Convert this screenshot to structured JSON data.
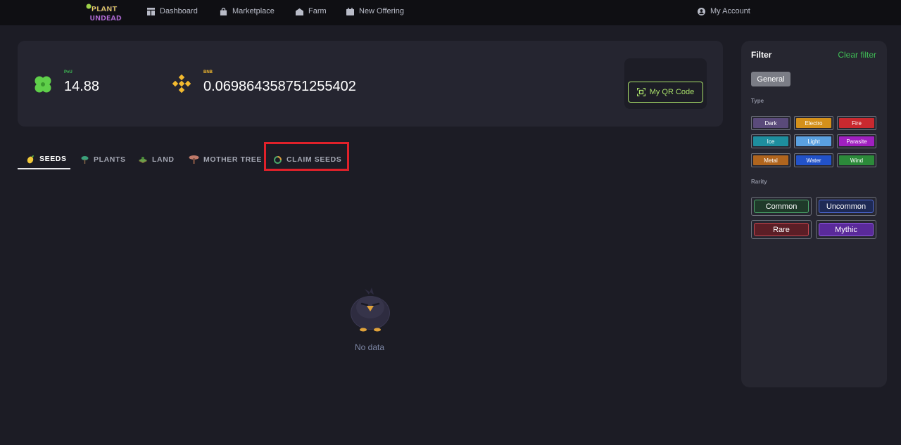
{
  "nav": {
    "logo_top": "PLANT",
    "logo_bottom": "UNDEAD",
    "items": [
      {
        "label": "Dashboard",
        "icon": "dashboard-icon"
      },
      {
        "label": "Marketplace",
        "icon": "marketplace-icon"
      },
      {
        "label": "Farm",
        "icon": "farm-icon"
      },
      {
        "label": "New Offering",
        "icon": "calendar-icon"
      }
    ],
    "account": "My Account"
  },
  "balances": {
    "pvu_label": "PvU",
    "pvu_value": "14.88",
    "bnb_label": "BNB",
    "bnb_value": "0.069864358751255402",
    "qr_button": "My QR Code"
  },
  "tabs": [
    {
      "label": "SEEDS",
      "icon": "seed-icon",
      "active": true
    },
    {
      "label": "PLANTS",
      "icon": "plant-icon"
    },
    {
      "label": "LAND",
      "icon": "land-icon"
    },
    {
      "label": "MOTHER TREE",
      "icon": "tree-icon"
    },
    {
      "label": "CLAIM SEEDS",
      "icon": "claim-icon"
    }
  ],
  "empty_state": {
    "text": "No data"
  },
  "filter": {
    "title": "Filter",
    "clear": "Clear filter",
    "general": "General",
    "type_label": "Type",
    "types": [
      {
        "label": "Dark",
        "color": "#5a4a7a"
      },
      {
        "label": "Electro",
        "color": "#d4901a"
      },
      {
        "label": "Fire",
        "color": "#c9292f"
      },
      {
        "label": "Ice",
        "color": "#1e8e9e"
      },
      {
        "label": "Light",
        "color": "#5aa0e0"
      },
      {
        "label": "Parasite",
        "color": "#a020c0"
      },
      {
        "label": "Metal",
        "color": "#b0651e"
      },
      {
        "label": "Water",
        "color": "#2252c8"
      },
      {
        "label": "Wind",
        "color": "#2c8a3a"
      }
    ],
    "rarity_label": "Rarity",
    "rarities": [
      {
        "label": "Common",
        "bg": "#1f3a2a",
        "border": "#4aa569"
      },
      {
        "label": "Uncommon",
        "bg": "#1e2a55",
        "border": "#4f6ad8"
      },
      {
        "label": "Rare",
        "bg": "#5b1e26",
        "border": "#c24650"
      },
      {
        "label": "Mythic",
        "bg": "#5a2a9a",
        "border": "#8f5ae0"
      }
    ]
  },
  "colors": {
    "accent_green": "#a9e06a",
    "pvu_label": "#3fbe55",
    "bnb_label": "#f3ba2f",
    "highlight": "#e0212a"
  }
}
